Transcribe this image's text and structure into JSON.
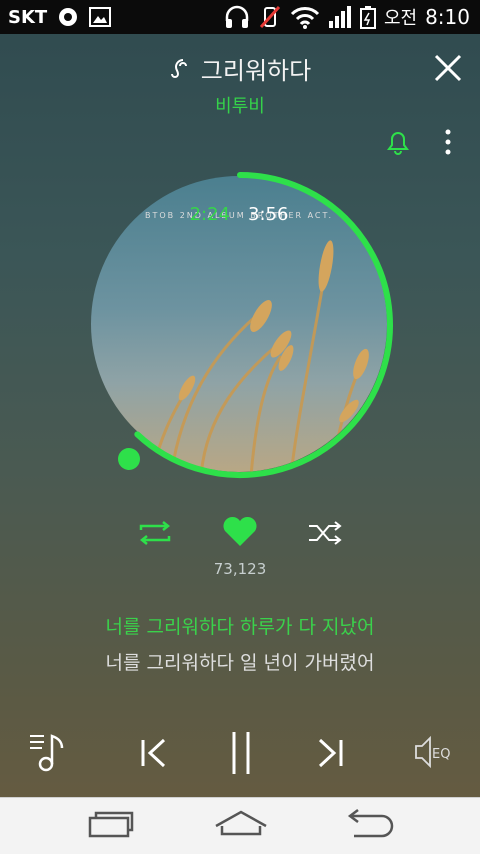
{
  "status": {
    "carrier": "SKT",
    "time": "8:10",
    "ampm": "오전"
  },
  "song": {
    "title": "그리워하다",
    "artist": "비투비",
    "album_text": "BTOB 2ND ALBUM   BROTHER ACT.",
    "current_time": "2:24",
    "total_time": "3:56",
    "progress": 0.62
  },
  "likes": {
    "count": "73,123"
  },
  "lyrics": {
    "current": "너를 그리워하다 하루가 다 지났어",
    "next": "너를 그리워하다 일 년이 가버렸어"
  },
  "colors": {
    "accent": "#2ee04a"
  }
}
